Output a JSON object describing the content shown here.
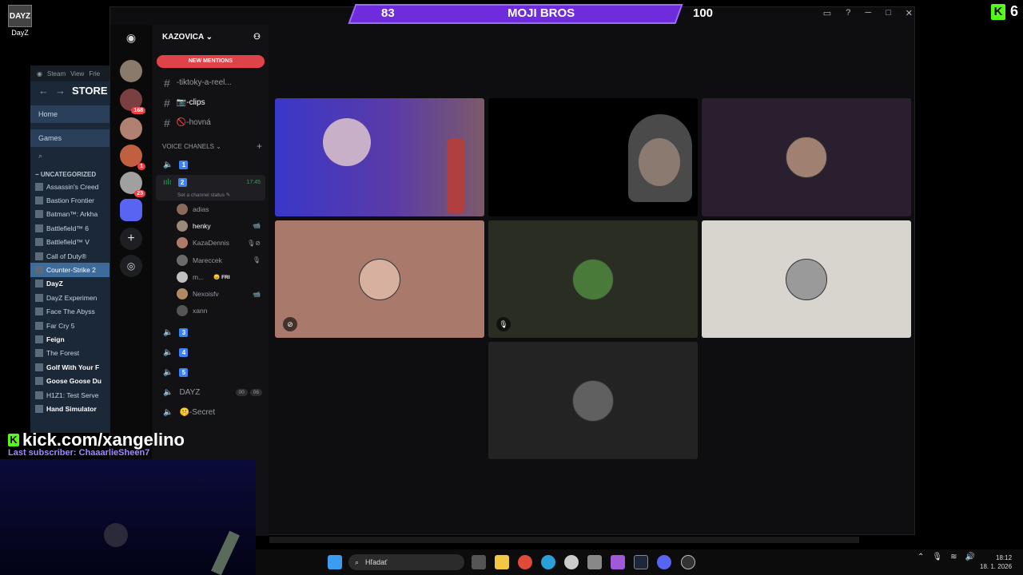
{
  "desktop": {
    "icon_label": "DayZ",
    "icon_text": "DAYZ"
  },
  "steam": {
    "menu": [
      "Steam",
      "View",
      "Frie"
    ],
    "store": "STORE",
    "home": "Home",
    "games": "Games",
    "category": "UNCATEGORIZED",
    "games_list": [
      {
        "name": "Assassin's Creed",
        "bold": false,
        "sel": false
      },
      {
        "name": "Bastion Frontier",
        "bold": false,
        "sel": false
      },
      {
        "name": "Batman™: Arkha",
        "bold": false,
        "sel": false
      },
      {
        "name": "Battlefield™ 6",
        "bold": false,
        "sel": false
      },
      {
        "name": "Battlefield™ V",
        "bold": false,
        "sel": false
      },
      {
        "name": "Call of Duty®",
        "bold": false,
        "sel": false
      },
      {
        "name": "Counter-Strike 2",
        "bold": false,
        "sel": true
      },
      {
        "name": "DayZ",
        "bold": true,
        "sel": false
      },
      {
        "name": "DayZ Experimen",
        "bold": false,
        "sel": false
      },
      {
        "name": "Face The Abyss",
        "bold": false,
        "sel": false
      },
      {
        "name": "Far Cry 5",
        "bold": false,
        "sel": false
      },
      {
        "name": "Feign",
        "bold": true,
        "sel": false
      },
      {
        "name": "The Forest",
        "bold": false,
        "sel": false
      },
      {
        "name": "Golf With Your F",
        "bold": true,
        "sel": false
      },
      {
        "name": "Goose Goose Du",
        "bold": true,
        "sel": false
      },
      {
        "name": "H1Z1: Test Serve",
        "bold": false,
        "sel": false
      },
      {
        "name": "Hand Simulator",
        "bold": true,
        "sel": false
      }
    ]
  },
  "discord": {
    "server_name": "KAZOVICA",
    "new_mentions": "NEW MENTIONS",
    "text_channels": [
      {
        "name": "-tiktoky-a-reel...",
        "active": false
      },
      {
        "name": "📷-clips",
        "active": true
      },
      {
        "name": "🚫-hovná",
        "active": false
      }
    ],
    "voice_section": "VOICE CHANELS",
    "voice_1": "1",
    "voice_active": {
      "name": "2",
      "time": "17:45",
      "status": "Set a channel status"
    },
    "users": [
      {
        "name": "adias",
        "extra": "",
        "bold": false
      },
      {
        "name": "henky",
        "extra": "📹",
        "bold": true
      },
      {
        "name": "KazaDennis",
        "extra": "🎙⊘",
        "bold": false
      },
      {
        "name": "Mareccek",
        "extra": "🎙",
        "bold": false
      },
      {
        "name": "m...",
        "extra": "",
        "bold": false,
        "badge": "😠 FRI"
      },
      {
        "name": "Nexoisfv",
        "extra": "📹",
        "bold": false
      },
      {
        "name": "xann",
        "extra": "",
        "bold": false
      }
    ],
    "voice_more": [
      "3",
      "4",
      "5"
    ],
    "dayz_channel": {
      "name": "DAYZ",
      "c1": "00",
      "c2": "06"
    },
    "secret_channel": "🤫-Secret",
    "server_badges": [
      "168",
      "1",
      "23"
    ]
  },
  "scoreboard": {
    "left": "83",
    "title": "MOJI BROS",
    "right": "100"
  },
  "kick": {
    "corner": "6",
    "url": "kick.com/xangelino",
    "last_sub": "Last subscriber: ChaaarlieSheen7"
  },
  "taskbar": {
    "search": "Hľadať",
    "time": "18:12",
    "date": "18. 1. 2026"
  }
}
